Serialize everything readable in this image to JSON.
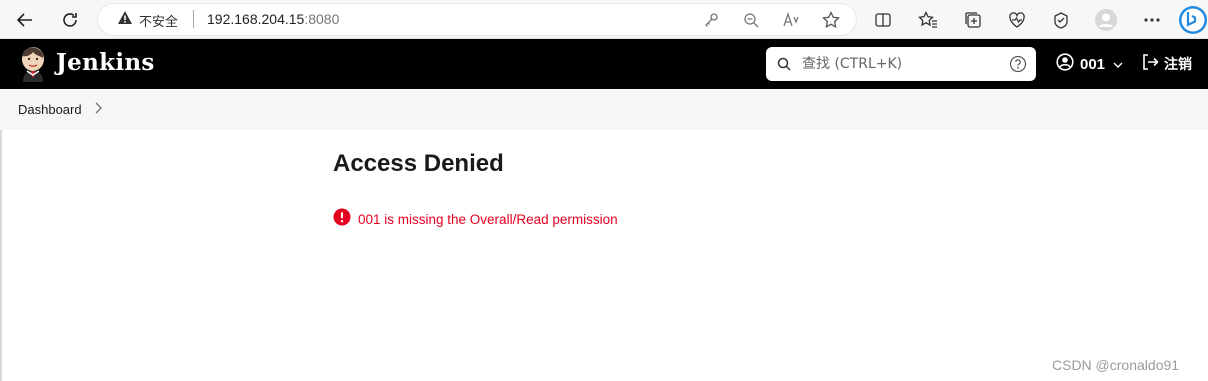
{
  "browser": {
    "insecure_label": "不安全",
    "url_host": "192.168.204.15",
    "url_port": ":8080",
    "icons": [
      "back-icon",
      "refresh-icon",
      "warning-icon",
      "key-icon",
      "zoom-out-icon",
      "read-aloud-icon",
      "favorite-star-icon",
      "split-screen-icon",
      "favorites-icon",
      "collections-icon",
      "browser-essentials-icon",
      "extensions-icon",
      "profile-icon",
      "more-icon",
      "bing-icon"
    ]
  },
  "header": {
    "brand": "Jenkins",
    "search_placeholder": "查找 (CTRL+K)",
    "user_name": "001",
    "logout_label": "注销"
  },
  "breadcrumb": {
    "items": [
      "Dashboard"
    ]
  },
  "main": {
    "title": "Access Denied",
    "error_message": "001 is missing the Overall/Read permission"
  },
  "watermark": "CSDN @cronaldo91",
  "colors": {
    "header_bg": "#000000",
    "error": "#e6001f",
    "breadcrumb_bg": "#f6f6f7"
  }
}
